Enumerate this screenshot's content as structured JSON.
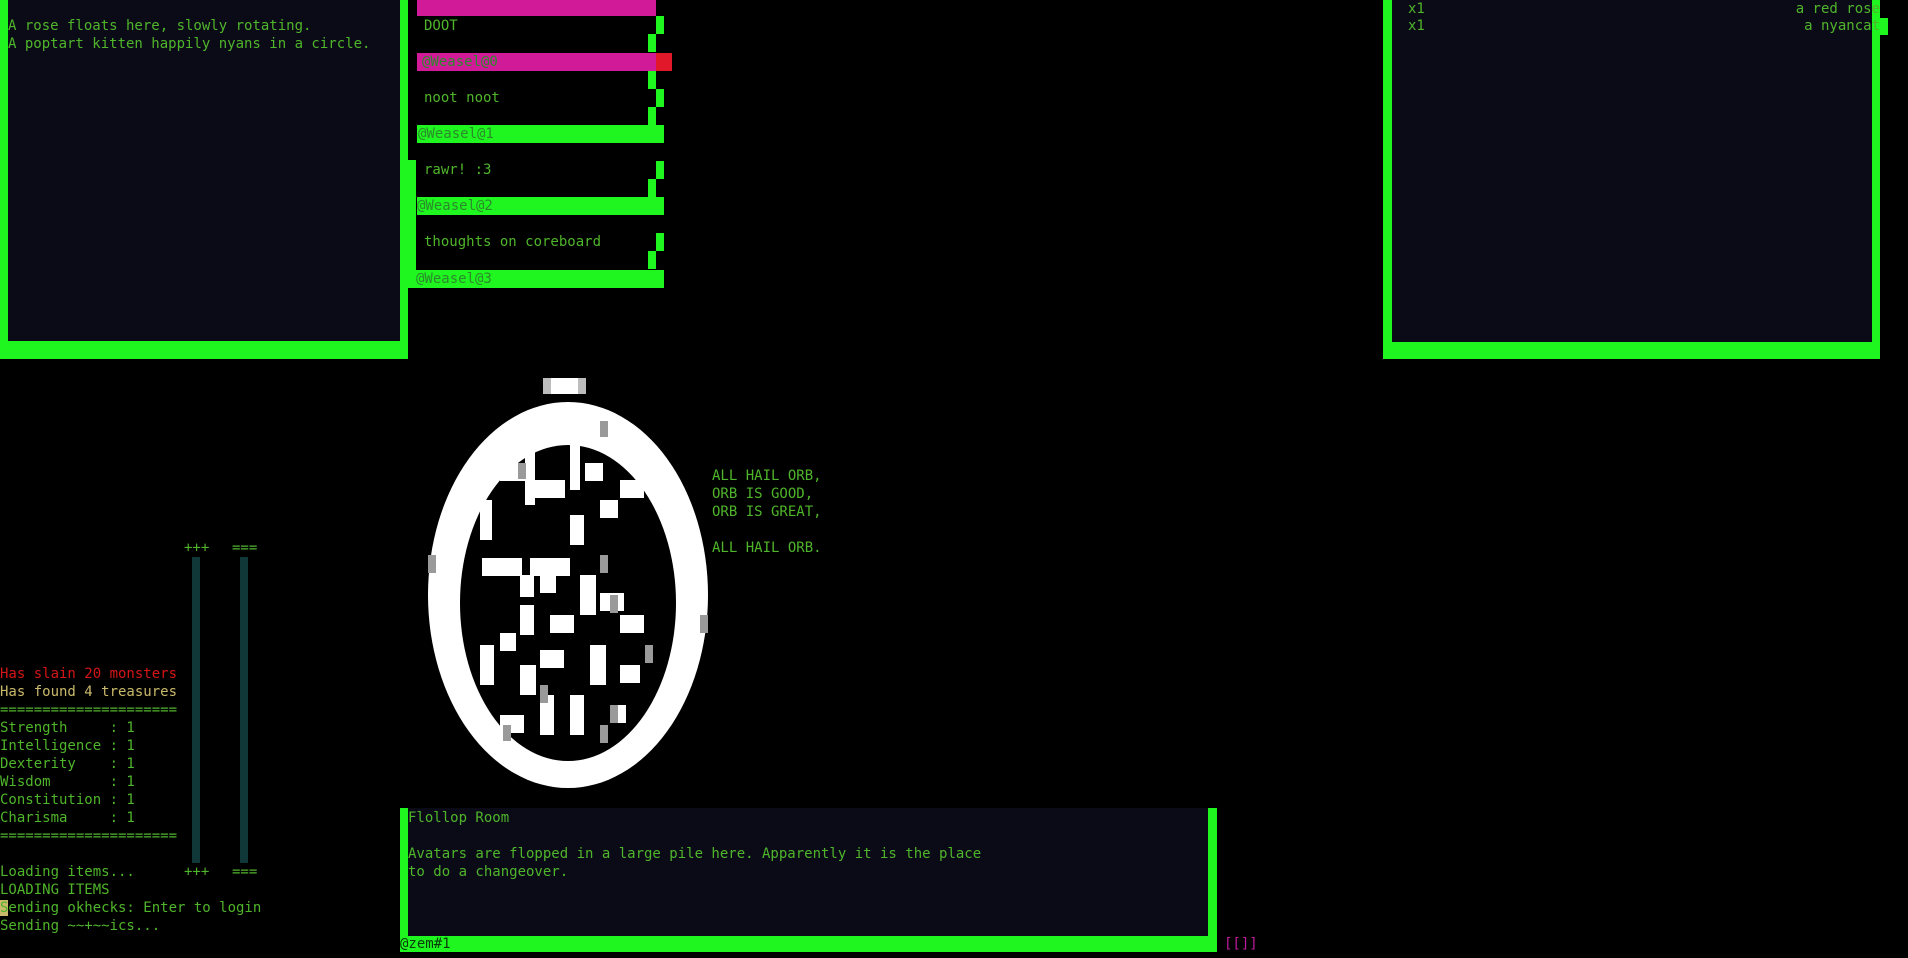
{
  "room_panel": {
    "lines": [
      "A rose floats here, slowly rotating.",
      "A poptart kitten happily nyans in a circle."
    ]
  },
  "chat": {
    "messages": [
      {
        "text": "DOOT",
        "author": "@Weasel@0"
      },
      {
        "text": "noot noot",
        "author": "@Weasel@1"
      },
      {
        "text": "rawr! :3",
        "author": "@Weasel@2"
      },
      {
        "text": "thoughts on coreboard",
        "author": "@Weasel@3"
      }
    ]
  },
  "inventory": {
    "items": [
      {
        "qty": "x1",
        "name": "a red rose"
      },
      {
        "qty": "x1",
        "name": "a nyancat"
      }
    ]
  },
  "orb_chant": {
    "lines": [
      "ALL HAIL ORB,",
      "ORB IS GOOD,",
      "ORB IS GREAT,",
      "",
      "ALL HAIL ORB."
    ]
  },
  "gauges": {
    "plus_label": "+++",
    "equal_label": "===",
    "colors": {
      "track": "#113838"
    }
  },
  "stats": {
    "slain": "Has slain 20 monsters",
    "found": "Has found 4 treasures",
    "divider": "=====================",
    "rows": [
      "Strength     : 1",
      "Intelligence : 1",
      "Dexterity    : 1",
      "Wisdom       : 1",
      "Constitution : 1",
      "Charisma     : 1"
    ]
  },
  "log": {
    "lines": [
      "Loading items...",
      "LOADING ITEMS",
      "Sending okhecks: Enter to login",
      "Sending ~~+~~ics..."
    ]
  },
  "location": {
    "title": "Flollop Room",
    "description_line1": "Avatars are flopped in a large pile here. Apparently it is the place",
    "description_line2": "to do a changeover."
  },
  "input_bar": {
    "value": "@zem#1",
    "suffix": "[[]]"
  },
  "colors": {
    "border": "#1ff51f",
    "panel": "#0b0b18",
    "text": "#4fb52a",
    "alert": "#d41616",
    "highlight": "#d01a98"
  }
}
